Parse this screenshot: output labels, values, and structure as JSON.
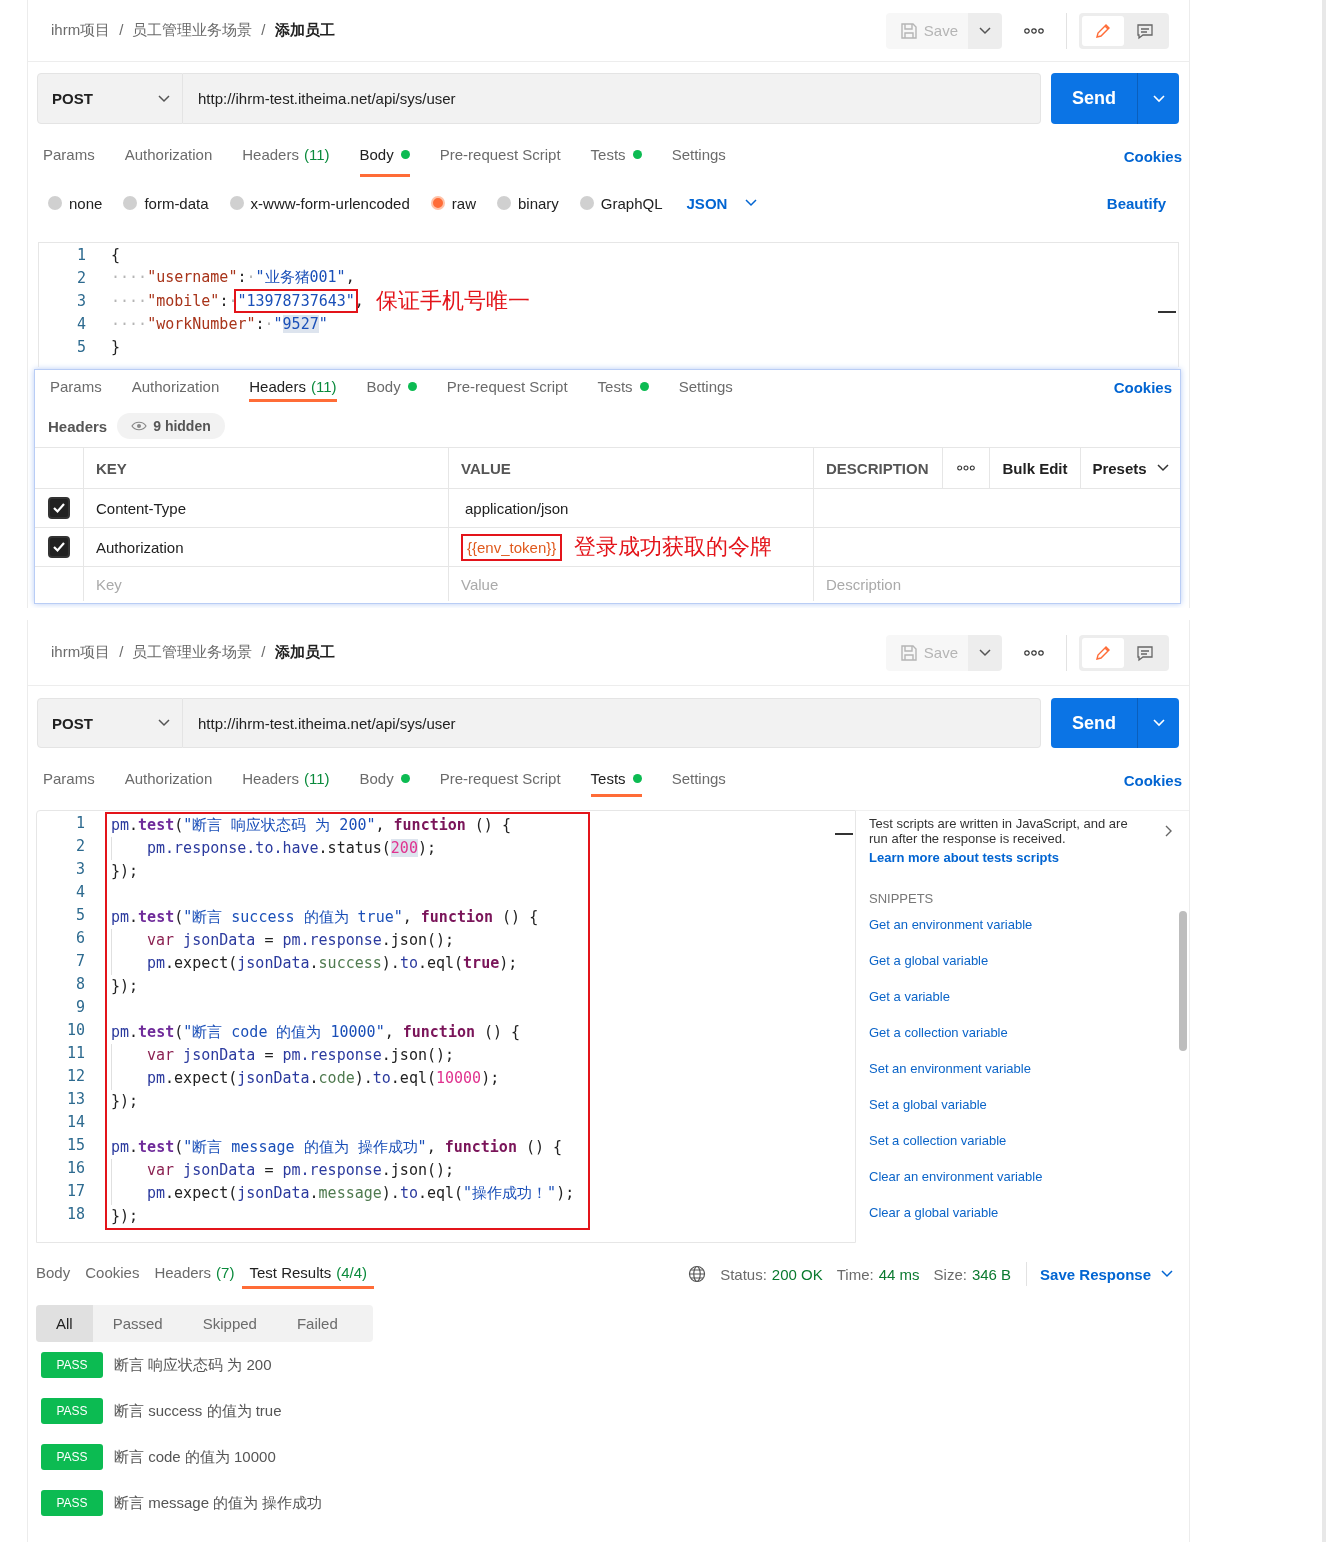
{
  "views": [
    {
      "kind": "body",
      "breadcrumb": [
        "ihrm项目",
        "员工管理业务场景",
        "添加员工"
      ],
      "separator": "/",
      "save": "Save",
      "mode_toggle": [
        {
          "kind": "edit",
          "selected": true
        },
        {
          "kind": "comment",
          "selected": false
        }
      ],
      "method": "POST",
      "url": "http://ihrm-test.itheima.net/api/sys/user",
      "send": "Send",
      "tabs": [
        {
          "label": "Params",
          "selected": false
        },
        {
          "label": "Authorization",
          "selected": false
        },
        {
          "label": "Headers",
          "count": "(11)",
          "selected": false
        },
        {
          "label": "Body",
          "dot": true,
          "selected": true
        },
        {
          "label": "Pre-request Script",
          "selected": false
        },
        {
          "label": "Tests",
          "dot": true,
          "selected": false
        },
        {
          "label": "Settings",
          "selected": false
        }
      ],
      "cookies": "Cookies",
      "body_modes": [
        {
          "label": "none",
          "selected": false
        },
        {
          "label": "form-data",
          "selected": false
        },
        {
          "label": "x-www-form-urlencoded",
          "selected": false
        },
        {
          "label": "raw",
          "selected": true
        },
        {
          "label": "binary",
          "selected": false
        },
        {
          "label": "GraphQL",
          "selected": false
        }
      ],
      "format": "JSON",
      "beautify": "Beautify",
      "lines": [
        {
          "n": "1",
          "tokens": [
            {
              "text": "{",
              "kind": "plain"
            }
          ]
        },
        {
          "n": "2",
          "tokens": [
            {
              "text": "····",
              "kind": "ws"
            },
            {
              "text": "\"username\"",
              "kind": "key"
            },
            {
              "text": ":",
              "kind": "plain"
            },
            {
              "text": "·",
              "kind": "ws"
            },
            {
              "text": "\"业务猪001\"",
              "kind": "str"
            },
            {
              "text": ",",
              "kind": "plain"
            }
          ]
        },
        {
          "n": "3",
          "tokens": [
            {
              "text": "····",
              "kind": "ws"
            },
            {
              "text": "\"mobile\"",
              "kind": "key"
            },
            {
              "text": ":",
              "kind": "plain"
            },
            {
              "text": "·",
              "kind": "ws"
            },
            {
              "text": "\"13978737643\"",
              "kind": "str",
              "boxed": true
            },
            {
              "text": ",",
              "kind": "plain"
            }
          ],
          "note": "保证手机号唯一"
        },
        {
          "n": "4",
          "tokens": [
            {
              "text": "····",
              "kind": "ws"
            },
            {
              "text": "\"workNumber\"",
              "kind": "key"
            },
            {
              "text": ":",
              "kind": "plain"
            },
            {
              "text": "·",
              "kind": "ws"
            },
            {
              "text": "\"",
              "kind": "str"
            },
            {
              "text": "9527",
              "kind": "str",
              "highlight": true
            },
            {
              "text": "\"",
              "kind": "str"
            }
          ]
        },
        {
          "n": "5",
          "tokens": [
            {
              "text": "}",
              "kind": "plain"
            }
          ]
        }
      ],
      "headers_panel": {
        "tabs": [
          {
            "label": "Params",
            "selected": false
          },
          {
            "label": "Authorization",
            "selected": false
          },
          {
            "label": "Headers",
            "count": "(11)",
            "selected": true
          },
          {
            "label": "Body",
            "dot": true,
            "selected": false
          },
          {
            "label": "Pre-request Script",
            "selected": false
          },
          {
            "label": "Tests",
            "dot": true,
            "selected": false
          },
          {
            "label": "Settings",
            "selected": false
          }
        ],
        "cookies": "Cookies",
        "title": "Headers",
        "hidden": "9 hidden",
        "columns": [
          "KEY",
          "VALUE",
          "DESCRIPTION"
        ],
        "bulk_edit": "Bulk Edit",
        "presets": "Presets",
        "rows": [
          {
            "checked": true,
            "key": "Content-Type",
            "value": "application/json",
            "kind": "text",
            "boxed": false
          },
          {
            "checked": true,
            "key": "Authorization",
            "value": "{{env_token}}",
            "kind": "variable",
            "boxed": true,
            "note": "登录成功获取的令牌"
          }
        ],
        "placeholders": [
          "Key",
          "Value",
          "Description"
        ]
      }
    },
    {
      "kind": "tests",
      "breadcrumb": [
        "ihrm项目",
        "员工管理业务场景",
        "添加员工"
      ],
      "separator": "/",
      "save": "Save",
      "mode_toggle": [
        {
          "kind": "edit",
          "selected": true
        },
        {
          "kind": "comment",
          "selected": false
        }
      ],
      "method": "POST",
      "url": "http://ihrm-test.itheima.net/api/sys/user",
      "send": "Send",
      "tabs": [
        {
          "label": "Params",
          "selected": false
        },
        {
          "label": "Authorization",
          "selected": false
        },
        {
          "label": "Headers",
          "count": "(11)",
          "selected": false
        },
        {
          "label": "Body",
          "dot": true,
          "selected": false
        },
        {
          "label": "Pre-request Script",
          "selected": false
        },
        {
          "label": "Tests",
          "dot": true,
          "selected": true
        },
        {
          "label": "Settings",
          "selected": false
        }
      ],
      "cookies": "Cookies",
      "boxed": true,
      "lines": [
        {
          "n": "1",
          "tokens": [
            {
              "text": "pm",
              "kind": "obj"
            },
            {
              "text": ".",
              "kind": "plain"
            },
            {
              "text": "test",
              "kind": "method"
            },
            {
              "text": "(",
              "kind": "plain"
            },
            {
              "text": "\"断言 响应状态码 为 200\"",
              "kind": "str"
            },
            {
              "text": ", ",
              "kind": "plain"
            },
            {
              "text": "function",
              "kind": "kw"
            },
            {
              "text": " () {",
              "kind": "plain"
            }
          ]
        },
        {
          "n": "2",
          "indent": true,
          "tokens": [
            {
              "text": "pm.response.to.have",
              "kind": "obj"
            },
            {
              "text": ".status(",
              "kind": "plain"
            },
            {
              "text": "200",
              "kind": "num",
              "highlight": true
            },
            {
              "text": ");",
              "kind": "plain"
            }
          ]
        },
        {
          "n": "3",
          "tokens": [
            {
              "text": "});",
              "kind": "plain"
            }
          ]
        },
        {
          "n": "4"
        },
        {
          "n": "5",
          "tokens": [
            {
              "text": "pm",
              "kind": "obj"
            },
            {
              "text": ".",
              "kind": "plain"
            },
            {
              "text": "test",
              "kind": "method"
            },
            {
              "text": "(",
              "kind": "plain"
            },
            {
              "text": "\"断言 success 的值为 true\"",
              "kind": "str"
            },
            {
              "text": ", ",
              "kind": "plain"
            },
            {
              "text": "function",
              "kind": "kw"
            },
            {
              "text": " () {",
              "kind": "plain"
            }
          ]
        },
        {
          "n": "6",
          "indent": true,
          "tokens": [
            {
              "text": "var",
              "kind": "var"
            },
            {
              "text": " jsonData",
              "kind": "obj"
            },
            {
              "text": " = ",
              "kind": "plain"
            },
            {
              "text": "pm.response",
              "kind": "obj"
            },
            {
              "text": ".json();",
              "kind": "plain"
            }
          ]
        },
        {
          "n": "7",
          "indent": true,
          "tokens": [
            {
              "text": "pm",
              "kind": "obj"
            },
            {
              "text": ".expect(",
              "kind": "plain"
            },
            {
              "text": "jsonData",
              "kind": "obj"
            },
            {
              "text": ".",
              "kind": "plain"
            },
            {
              "text": "success",
              "kind": "prop"
            },
            {
              "text": ").",
              "kind": "plain"
            },
            {
              "text": "to",
              "kind": "obj"
            },
            {
              "text": ".eql(",
              "kind": "plain"
            },
            {
              "text": "true",
              "kind": "kw"
            },
            {
              "text": ");",
              "kind": "plain"
            }
          ]
        },
        {
          "n": "8",
          "tokens": [
            {
              "text": "});",
              "kind": "plain"
            }
          ]
        },
        {
          "n": "9"
        },
        {
          "n": "10",
          "tokens": [
            {
              "text": "pm",
              "kind": "obj"
            },
            {
              "text": ".",
              "kind": "plain"
            },
            {
              "text": "test",
              "kind": "method"
            },
            {
              "text": "(",
              "kind": "plain"
            },
            {
              "text": "\"断言 code 的值为 10000\"",
              "kind": "str"
            },
            {
              "text": ", ",
              "kind": "plain"
            },
            {
              "text": "function",
              "kind": "kw"
            },
            {
              "text": " () {",
              "kind": "plain"
            }
          ]
        },
        {
          "n": "11",
          "indent": true,
          "tokens": [
            {
              "text": "var",
              "kind": "var"
            },
            {
              "text": " jsonData",
              "kind": "obj"
            },
            {
              "text": " = ",
              "kind": "plain"
            },
            {
              "text": "pm.response",
              "kind": "obj"
            },
            {
              "text": ".json();",
              "kind": "plain"
            }
          ]
        },
        {
          "n": "12",
          "indent": true,
          "tokens": [
            {
              "text": "pm",
              "kind": "obj"
            },
            {
              "text": ".expect(",
              "kind": "plain"
            },
            {
              "text": "jsonData",
              "kind": "obj"
            },
            {
              "text": ".",
              "kind": "plain"
            },
            {
              "text": "code",
              "kind": "prop"
            },
            {
              "text": ").",
              "kind": "plain"
            },
            {
              "text": "to",
              "kind": "obj"
            },
            {
              "text": ".eql(",
              "kind": "plain"
            },
            {
              "text": "10000",
              "kind": "num"
            },
            {
              "text": ");",
              "kind": "plain"
            }
          ]
        },
        {
          "n": "13",
          "tokens": [
            {
              "text": "});",
              "kind": "plain"
            }
          ]
        },
        {
          "n": "14"
        },
        {
          "n": "15",
          "tokens": [
            {
              "text": "pm",
              "kind": "obj"
            },
            {
              "text": ".",
              "kind": "plain"
            },
            {
              "text": "test",
              "kind": "method"
            },
            {
              "text": "(",
              "kind": "plain"
            },
            {
              "text": "\"断言 message 的值为 操作成功\"",
              "kind": "str"
            },
            {
              "text": ", ",
              "kind": "plain"
            },
            {
              "text": "function",
              "kind": "kw"
            },
            {
              "text": " () {",
              "kind": "plain"
            }
          ]
        },
        {
          "n": "16",
          "indent": true,
          "tokens": [
            {
              "text": "var",
              "kind": "var"
            },
            {
              "text": " jsonData",
              "kind": "obj"
            },
            {
              "text": " = ",
              "kind": "plain"
            },
            {
              "text": "pm.response",
              "kind": "obj"
            },
            {
              "text": ".json();",
              "kind": "plain"
            }
          ]
        },
        {
          "n": "17",
          "indent": true,
          "tokens": [
            {
              "text": "pm",
              "kind": "obj"
            },
            {
              "text": ".expect(",
              "kind": "plain"
            },
            {
              "text": "jsonData",
              "kind": "obj"
            },
            {
              "text": ".",
              "kind": "plain"
            },
            {
              "text": "message",
              "kind": "prop"
            },
            {
              "text": ").",
              "kind": "plain"
            },
            {
              "text": "to",
              "kind": "obj"
            },
            {
              "text": ".eql(",
              "kind": "plain"
            },
            {
              "text": "\"操作成功！\"",
              "kind": "str"
            },
            {
              "text": ");",
              "kind": "plain"
            }
          ]
        },
        {
          "n": "18",
          "tokens": [
            {
              "text": "});",
              "kind": "plain"
            }
          ]
        }
      ],
      "help": {
        "text": "Test scripts are written in JavaScript, and are run after the response is received.",
        "link": "Learn more about tests scripts",
        "snippets_title": "SNIPPETS",
        "snippets": [
          "Get an environment variable",
          "Get a global variable",
          "Get a variable",
          "Get a collection variable",
          "Set an environment variable",
          "Set a global variable",
          "Set a collection variable",
          "Clear an environment variable",
          "Clear a global variable"
        ]
      },
      "response": {
        "tabs": [
          {
            "label": "Body",
            "selected": false
          },
          {
            "label": "Cookies",
            "selected": false
          },
          {
            "label": "Headers",
            "count": "(7)",
            "selected": false
          },
          {
            "label": "Test Results",
            "count": "(4/4)",
            "selected": true
          }
        ],
        "status_label": "Status:",
        "status": "200 OK",
        "time_label": "Time:",
        "time": "44 ms",
        "size_label": "Size:",
        "size": "346 B",
        "save_response": "Save Response",
        "filters": [
          {
            "label": "All",
            "selected": true
          },
          {
            "label": "Passed",
            "selected": false
          },
          {
            "label": "Skipped",
            "selected": false
          },
          {
            "label": "Failed",
            "selected": false
          }
        ],
        "results": [
          {
            "status": "PASS",
            "name": "断言 响应状态码 为 200"
          },
          {
            "status": "PASS",
            "name": "断言 success 的值为 true"
          },
          {
            "status": "PASS",
            "name": "断言 code 的值为 10000"
          },
          {
            "status": "PASS",
            "name": "断言 message 的值为 操作成功"
          }
        ]
      }
    }
  ]
}
